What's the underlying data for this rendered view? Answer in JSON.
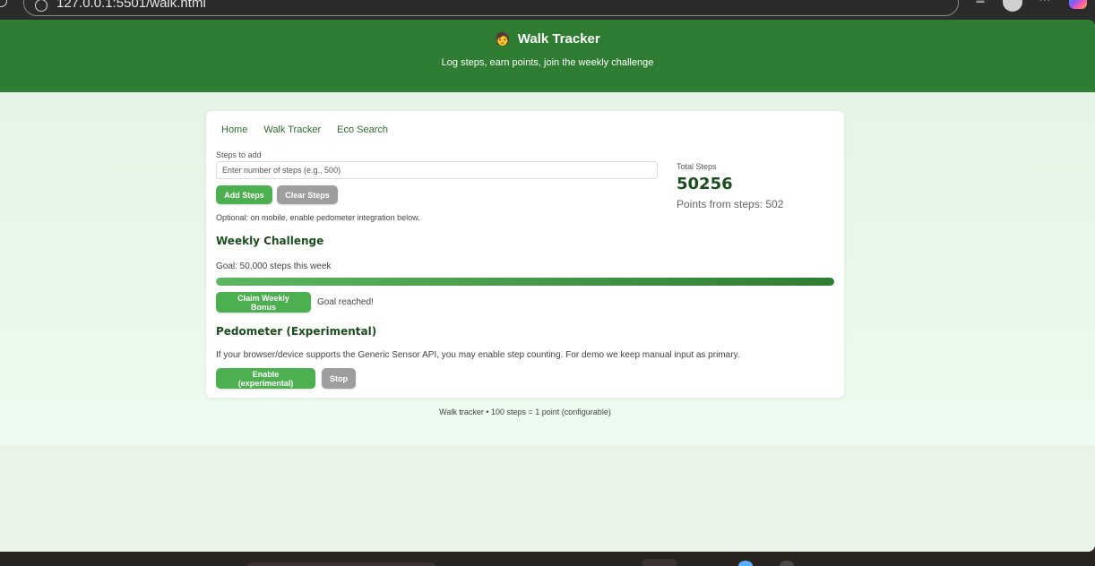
{
  "browser": {
    "url": "127.0.0.1:5501/walk.html"
  },
  "header": {
    "icon": "🧑",
    "title": "Walk Tracker",
    "subtitle": "Log steps, earn points, join the weekly challenge"
  },
  "nav": {
    "items": [
      {
        "label": "Home"
      },
      {
        "label": "Walk Tracker"
      },
      {
        "label": "Eco Search"
      }
    ]
  },
  "steps": {
    "label": "Steps to add",
    "input_value": "",
    "placeholder": "Enter number of steps (e.g., 500)",
    "add_label": "Add Steps",
    "clear_label": "Clear Steps",
    "optional_note": "Optional: on mobile, enable pedometer integration below."
  },
  "stats": {
    "total_label": "Total Steps",
    "total_value": "50256",
    "points_text": "Points from steps: 502"
  },
  "weekly": {
    "heading": "Weekly Challenge",
    "goal_text": "Goal: 50,000 steps this week",
    "progress_fraction": 1.0,
    "claim_label": "Claim Weekly Bonus",
    "status_text": "Goal reached!"
  },
  "pedometer": {
    "heading": "Pedometer (Experimental)",
    "note": "If your browser/device supports the Generic Sensor API, you may enable step counting. For demo we keep manual input as primary.",
    "enable_label": "Enable (experimental)",
    "stop_label": "Stop"
  },
  "footer": {
    "text": "Walk tracker • 100 steps = 1 point (configurable)"
  },
  "colors": {
    "header_green": "#2e7d32",
    "button_green": "#4caf50",
    "button_gray": "#9e9e9e",
    "page_background": "#e9f5e9"
  }
}
